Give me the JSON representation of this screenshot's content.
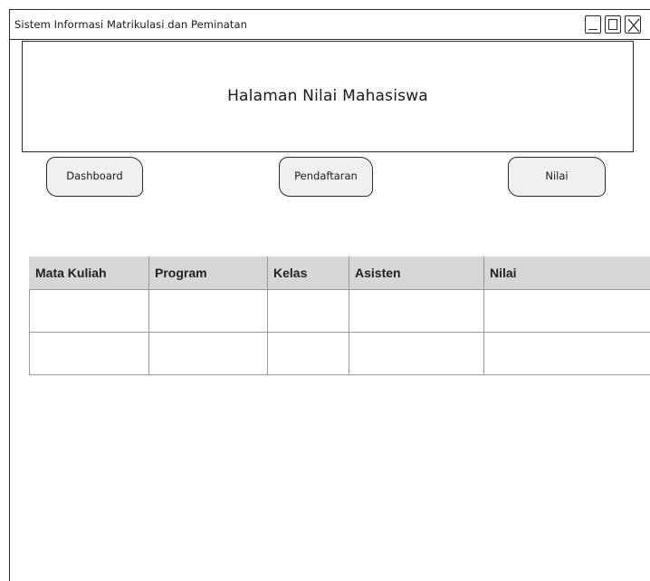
{
  "window": {
    "title": "Sistem Informasi Matrikulasi dan Peminatan",
    "controls": {
      "minimize_icon": "minimize-icon",
      "maximize_icon": "maximize-icon",
      "close_icon": "close-icon"
    }
  },
  "header": {
    "title": "Halaman Nilai Mahasiswa"
  },
  "nav": {
    "dashboard_label": "Dashboard",
    "pendaftaran_label": "Pendaftaran",
    "nilai_label": "Nilai"
  },
  "table": {
    "columns": [
      "Mata Kuliah",
      "Program",
      "Kelas",
      "Asisten",
      "Nilai"
    ],
    "rows": [
      [
        "",
        "",
        "",
        "",
        ""
      ],
      [
        "",
        "",
        "",
        "",
        ""
      ]
    ]
  },
  "colors": {
    "border": "#2a2a2a",
    "table_header_bg": "#d7d7d7",
    "button_bg": "#f0f0f0",
    "grid_line": "#9a9a9a"
  }
}
